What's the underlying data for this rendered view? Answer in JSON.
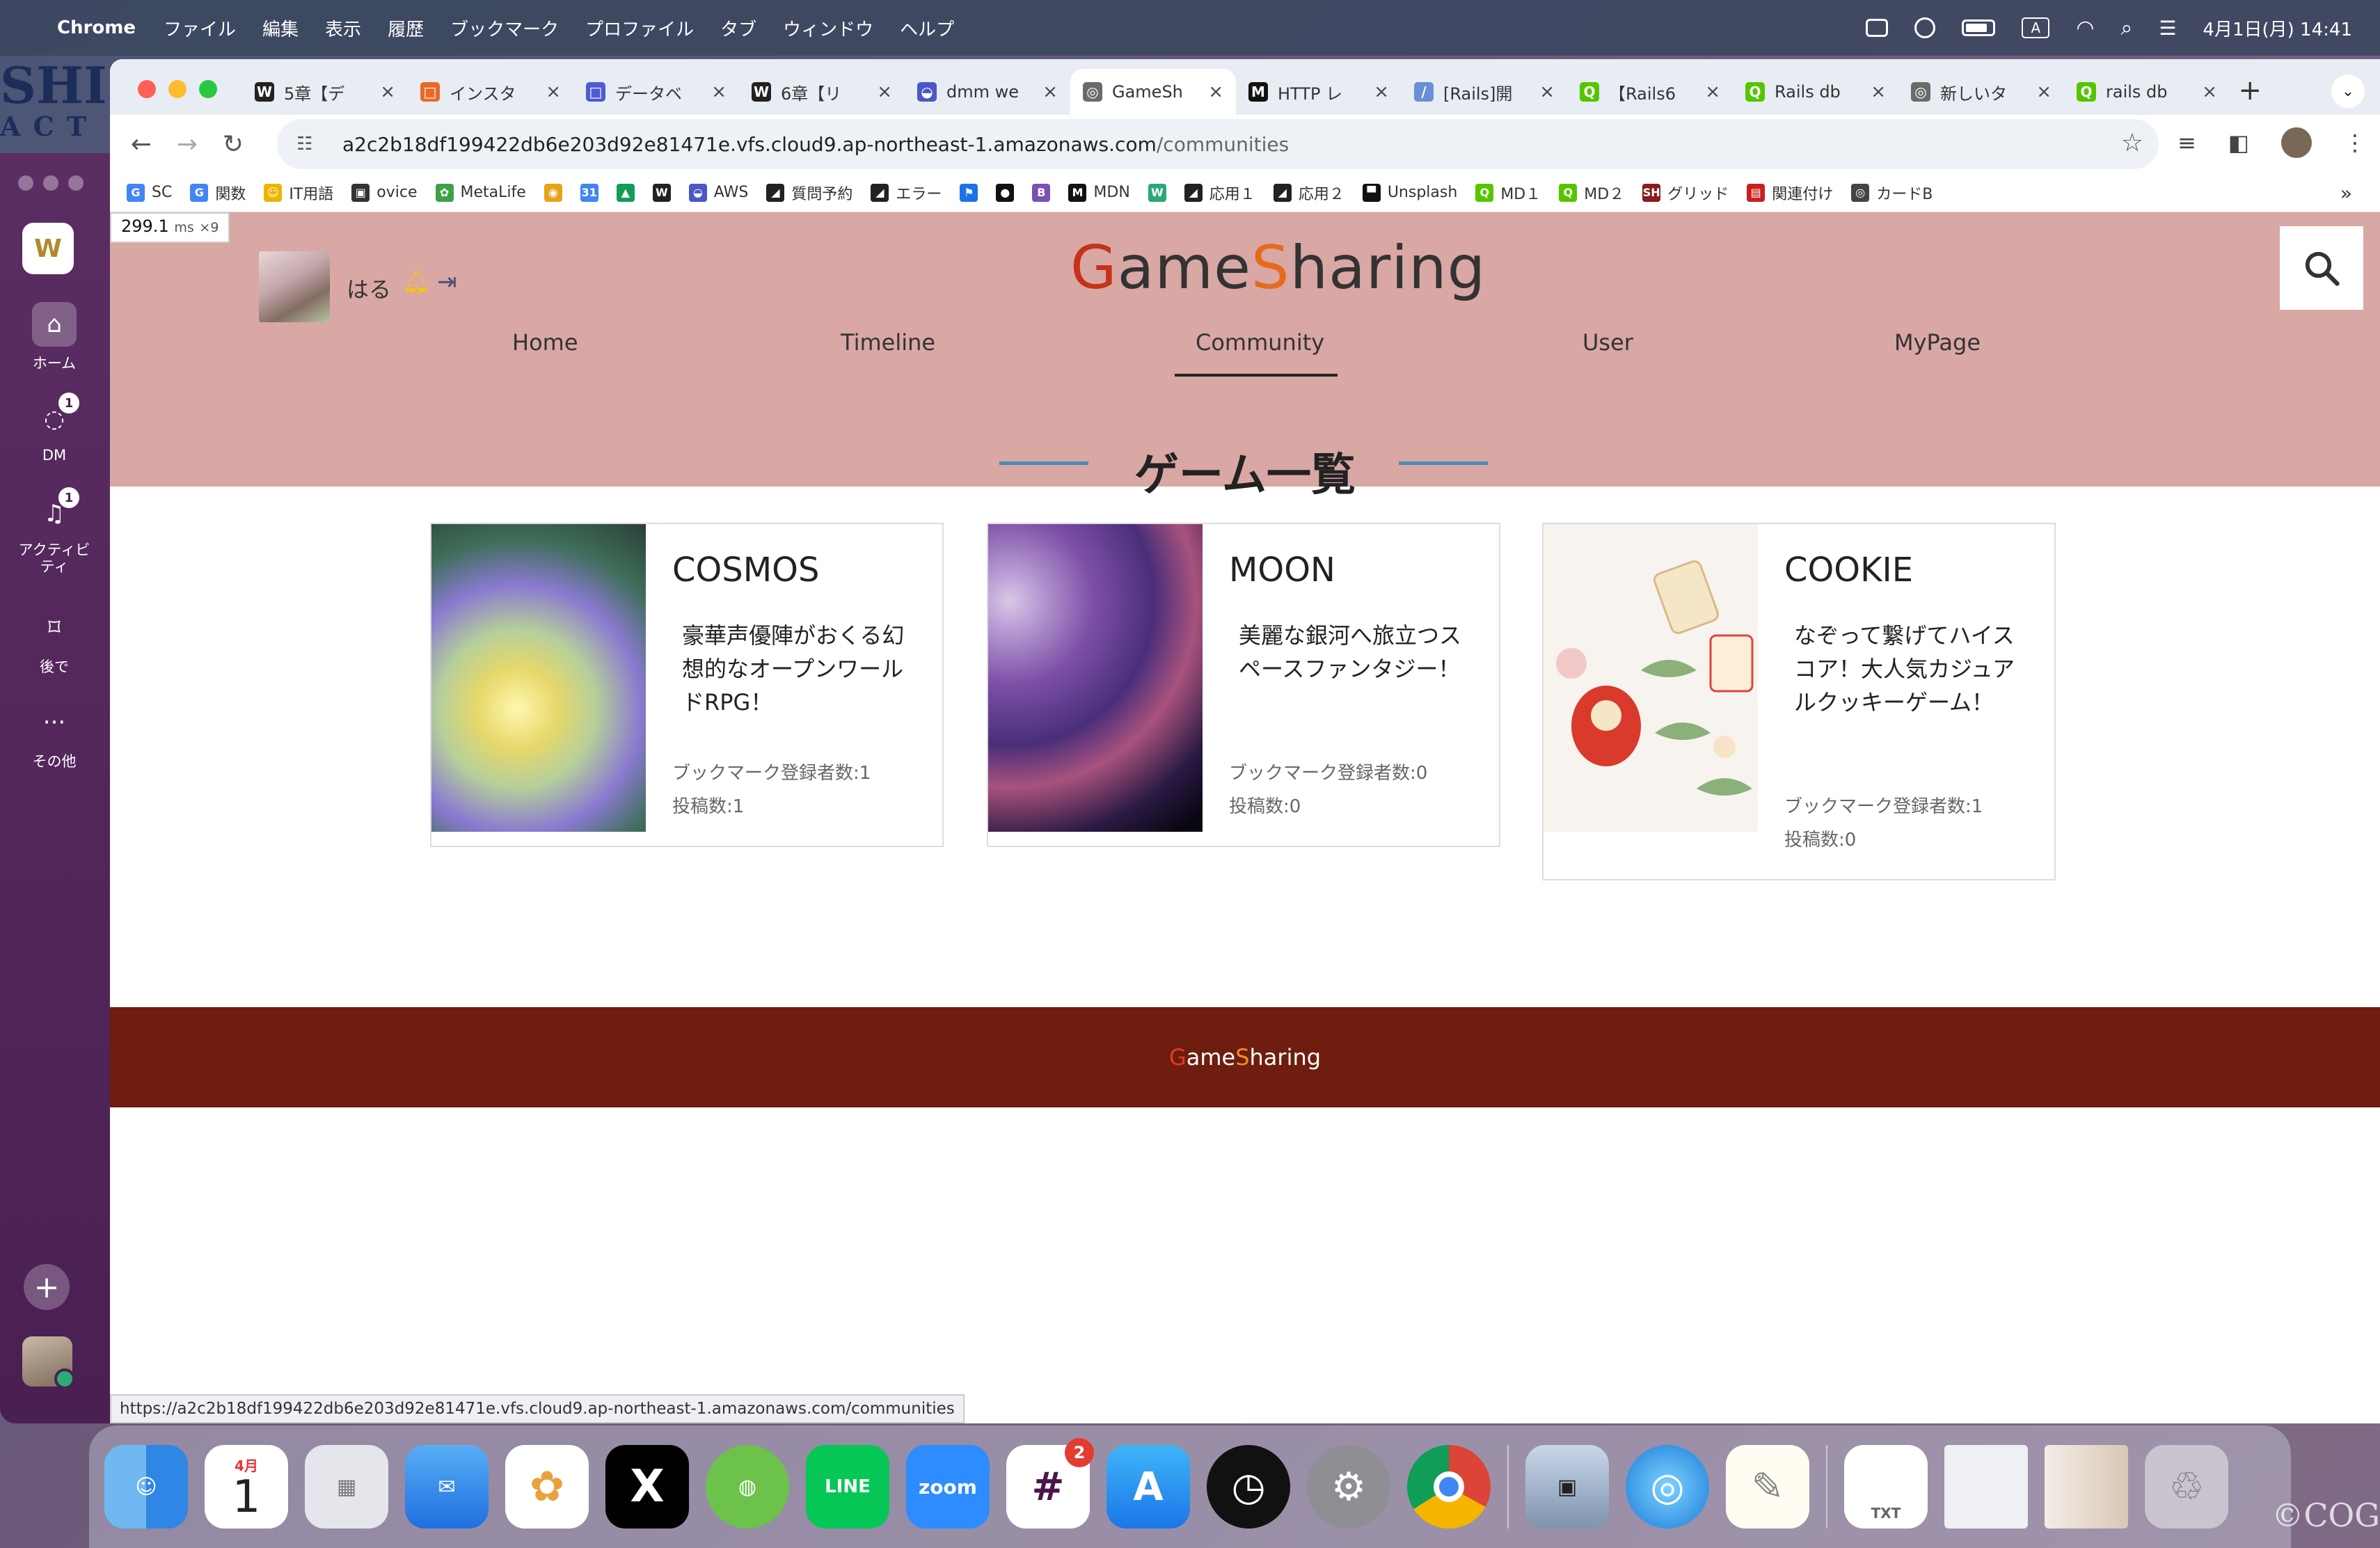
{
  "menubar": {
    "app_name": "Chrome",
    "items": [
      "ファイル",
      "編集",
      "表示",
      "履歴",
      "ブックマーク",
      "プロファイル",
      "タブ",
      "ウィンドウ",
      "ヘルプ"
    ],
    "input_mode": "A",
    "datetime": "4月1日(月) 14:41"
  },
  "bg_window": {
    "text1": "SHI",
    "text2": "ACT"
  },
  "slack": {
    "workspace": "W",
    "nav": [
      {
        "label": "ホーム",
        "icon": "home-icon",
        "badge": ""
      },
      {
        "label": "DM",
        "icon": "dm-icon",
        "badge": "1"
      },
      {
        "label": "アクティビティ",
        "icon": "bell-icon",
        "badge": "1"
      },
      {
        "label": "後で",
        "icon": "bookmark-icon",
        "badge": ""
      },
      {
        "label": "その他",
        "icon": "more-icon",
        "badge": ""
      }
    ]
  },
  "tabs": [
    {
      "title": "5章【デ",
      "color": "#222222",
      "letter": "W"
    },
    {
      "title": "インスタ",
      "color": "#e86a27",
      "letter": "□"
    },
    {
      "title": "データベ",
      "color": "#4f5bd5",
      "letter": "□"
    },
    {
      "title": "6章【リ",
      "color": "#222222",
      "letter": "W"
    },
    {
      "title": "dmm we",
      "color": "#4b57c8",
      "letter": "◒"
    },
    {
      "title": "GameSh",
      "color": "#6b6b6b",
      "letter": "◎",
      "active": true
    },
    {
      "title": "HTTP レ",
      "color": "#111111",
      "letter": "M"
    },
    {
      "title": "[Rails]開",
      "color": "#6a8ed8",
      "letter": "/"
    },
    {
      "title": "【Rails6",
      "color": "#55c500",
      "letter": "Q"
    },
    {
      "title": "Rails db",
      "color": "#55c500",
      "letter": "Q"
    },
    {
      "title": "新しいタ",
      "color": "#6b6b6b",
      "letter": "◎"
    },
    {
      "title": "rails db",
      "color": "#55c500",
      "letter": "Q"
    }
  ],
  "address": {
    "host": "a2c2b18df199422db6e203d92e81471e.vfs.cloud9.ap-northeast-1.amazonaws.com",
    "path": "/communities"
  },
  "bookmarks": [
    {
      "label": "SC",
      "color": "#4285f4",
      "letter": "G"
    },
    {
      "label": "関数",
      "color": "#4285f4",
      "letter": "G"
    },
    {
      "label": "IT用語",
      "color": "#f0b400",
      "letter": "☺"
    },
    {
      "label": "ovice",
      "color": "#333333",
      "letter": "▣"
    },
    {
      "label": "MetaLife",
      "color": "#3ea14a",
      "letter": "✿"
    },
    {
      "label": "",
      "color": "#e8a317",
      "letter": "◉"
    },
    {
      "label": "",
      "color": "#4285f4",
      "letter": "31"
    },
    {
      "label": "",
      "color": "#0f9d58",
      "letter": "▲"
    },
    {
      "label": "",
      "color": "#222222",
      "letter": "W"
    },
    {
      "label": "AWS",
      "color": "#4b57c8",
      "letter": "◒"
    },
    {
      "label": "質問予約",
      "color": "#222222",
      "letter": "◢"
    },
    {
      "label": "エラー",
      "color": "#222222",
      "letter": "◢"
    },
    {
      "label": "",
      "color": "#1a73e8",
      "letter": "⚑"
    },
    {
      "label": "",
      "color": "#111111",
      "letter": "●"
    },
    {
      "label": "",
      "color": "#7952b3",
      "letter": "B"
    },
    {
      "label": "MDN",
      "color": "#111111",
      "letter": "M"
    },
    {
      "label": "",
      "color": "#2aa876",
      "letter": "W"
    },
    {
      "label": "応用１",
      "color": "#222222",
      "letter": "◢"
    },
    {
      "label": "応用２",
      "color": "#222222",
      "letter": "◢"
    },
    {
      "label": "Unsplash",
      "color": "#111111",
      "letter": "▀"
    },
    {
      "label": "MD１",
      "color": "#55c500",
      "letter": "Q"
    },
    {
      "label": "MD２",
      "color": "#55c500",
      "letter": "Q"
    },
    {
      "label": "グリッド",
      "color": "#8b1a1a",
      "letter": "SH"
    },
    {
      "label": "関連付け",
      "color": "#c82020",
      "letter": "▤"
    },
    {
      "label": "カードB",
      "color": "#444444",
      "letter": "◎"
    }
  ],
  "perf": {
    "value": "299.1",
    "unit": "ms",
    "mult": "×9"
  },
  "site": {
    "user_name": "はる",
    "logo_first": "G",
    "logo_mid1": "ame",
    "logo_s": "S",
    "logo_rest": "haring",
    "nav": [
      "Home",
      "Timeline",
      "Community",
      "User",
      "MyPage"
    ],
    "active_nav": "Community",
    "section_title": "ゲーム一覧",
    "cards": [
      {
        "name": "COSMOS",
        "desc": "豪華声優陣がおくる幻想的なオープンワールドRPG！",
        "bookmarks": "ブックマーク登録者数:1",
        "posts": "投稿数:1"
      },
      {
        "name": "MOON",
        "desc": "美麗な銀河へ旅立つスペースファンタジー！",
        "bookmarks": "ブックマーク登録者数:0",
        "posts": "投稿数:0"
      },
      {
        "name": "COOKIE",
        "desc": "なぞって繋げてハイスコア！大人気カジュアルクッキーゲーム！",
        "bookmarks": "ブックマーク登録者数:1",
        "posts": "投稿数:0"
      }
    ],
    "footer_g": "G",
    "footer_ame": "ame",
    "footer_s": "S",
    "footer_rest": "haring"
  },
  "status_url": "https://a2c2b18df199422db6e203d92e81471e.vfs.cloud9.ap-northeast-1.amazonaws.com/communities",
  "dock": {
    "calendar_month": "4月",
    "calendar_day": "1",
    "slack_badge": "2",
    "apps": [
      "finder-icon",
      "calendar-icon",
      "launchpad-icon",
      "mail-icon",
      "photos-icon",
      "x-icon",
      "chatgpt-icon",
      "line-icon",
      "zoom-icon",
      "slack-icon",
      "appstore-icon",
      "clock-icon",
      "settings-icon",
      "chrome-icon",
      "preview-icon",
      "network-icon",
      "textedit-icon",
      "txt-file-icon",
      "screenshot-icon",
      "window-icon",
      "trash-icon"
    ],
    "line_label": "LINE",
    "zoom_label": "zoom",
    "txt_label": "TXT"
  },
  "watermark": "©COG"
}
